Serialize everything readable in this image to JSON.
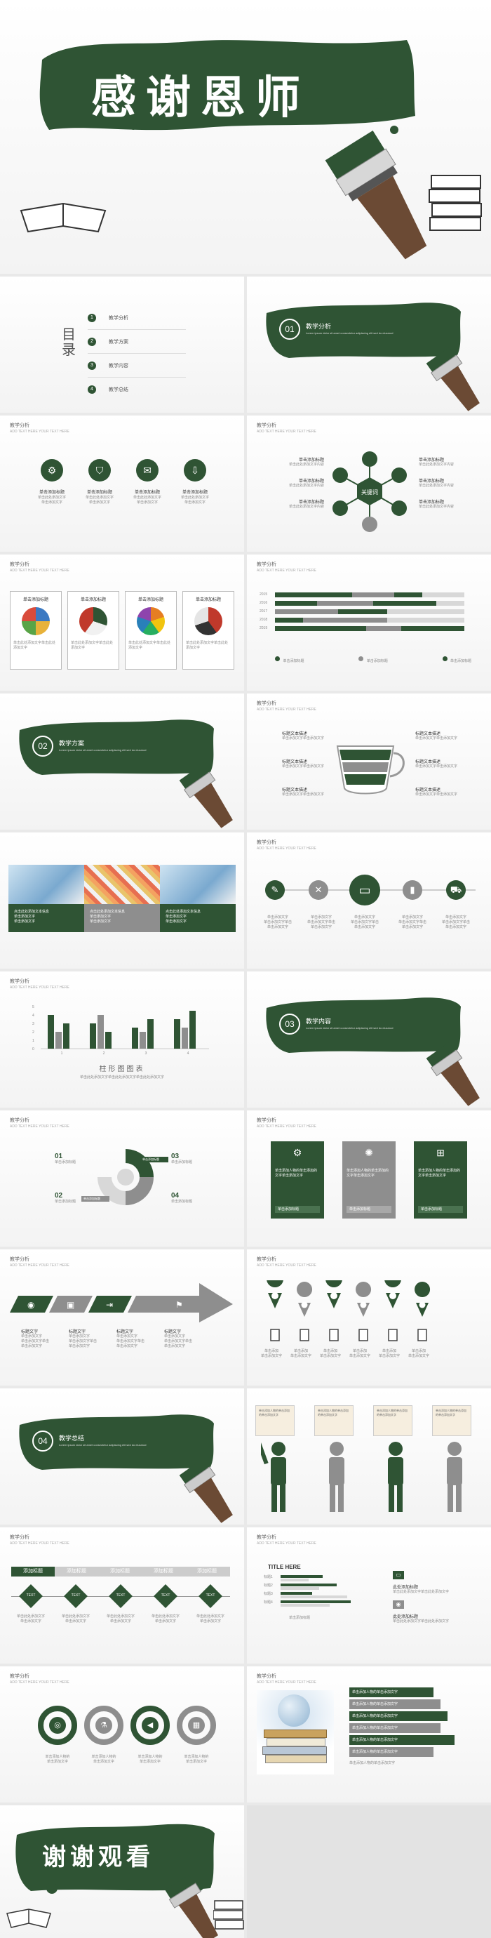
{
  "cover": {
    "title": "感谢恩师"
  },
  "toc": {
    "heading": "目录",
    "items": [
      {
        "num": "1",
        "label": "教学分析"
      },
      {
        "num": "2",
        "label": "教学方案"
      },
      {
        "num": "3",
        "label": "教学内容"
      },
      {
        "num": "4",
        "label": "教学总结"
      }
    ]
  },
  "header": {
    "title": "教学分析",
    "subtitle": "ADD TEXT HERE YOUR TEXT HERE"
  },
  "sections": [
    {
      "num": "01",
      "title": "教学分析",
      "sub": "Lorem ipsum dolor sit amet consectetur adipiscing elit sed do eiusmod"
    },
    {
      "num": "02",
      "title": "教学方案",
      "sub": "Lorem ipsum dolor sit amet consectetur adipiscing elit sed do eiusmod"
    },
    {
      "num": "03",
      "title": "教学内容",
      "sub": "Lorem ipsum dolor sit amet consectetur adipiscing elit sed do eiusmod"
    },
    {
      "num": "04",
      "title": "教学总结",
      "sub": "Lorem ipsum dolor sit amet consectetur adipiscing elit sed do eiusmod"
    }
  ],
  "four_icons": {
    "title": "单击添加标题",
    "desc": "单击此处添加文字\n单击添加文字"
  },
  "hub": {
    "center": "关键词",
    "label": "单击添加标题",
    "desc": "单击此处添加文字内容"
  },
  "cards": {
    "title": "单击添加标题",
    "desc": "单击此处添加文字单击此处添加文字"
  },
  "hbar": {
    "rows": [
      "2015",
      "2016",
      "2017",
      "2018",
      "2019"
    ],
    "legend": [
      "单击添加标题",
      "单击添加标题",
      "单击添加标题"
    ]
  },
  "cup": {
    "label": "标题文本描述",
    "desc": "单击添加文字单击添加文字"
  },
  "photos": {
    "desc": "点击此处添加文本信息\n单击添加文字\n单击添加文字"
  },
  "five_icons": {
    "desc": "单击添加文字\n单击添加文字单击\n单击添加文字"
  },
  "bars": {
    "caption": "柱形图图表",
    "y_ticks": [
      "5",
      "4",
      "3",
      "2",
      "1",
      "0"
    ],
    "categories": [
      "1",
      "2",
      "3",
      "4"
    ],
    "desc": "单击此处添加文字单击此处添加文字单击此处添加文字"
  },
  "donut": {
    "items": [
      {
        "num": "01",
        "label": "单击添加标题"
      },
      {
        "num": "02",
        "label": "单击添加标题"
      },
      {
        "num": "03",
        "label": "单击添加标题"
      },
      {
        "num": "04",
        "label": "单击添加标题"
      }
    ],
    "tags": [
      "单击添加标题",
      "单击添加标题"
    ]
  },
  "panels": {
    "text": "单击添加人物的单击添加的文字单击添加文字",
    "btn": "单击添加标题"
  },
  "arrow": {
    "labels": [
      "标题文字",
      "标题文字",
      "标题文字",
      "标题文字"
    ],
    "desc": "单击添加文字\n单击添加文字单击\n单击添加文字"
  },
  "pins": {
    "desc": "单击添加\n单击添加文字"
  },
  "people": {
    "bubble": "单击添加人物的单击添加的单击添加文字"
  },
  "timeline": {
    "steps": [
      "添加标题",
      "添加标题",
      "添加标题",
      "添加标题",
      "添加标题"
    ],
    "text": "TEXT",
    "desc": "单击此处添加文字\n单击添加文字"
  },
  "hbars2": {
    "title": "TITLE HERE",
    "rows": [
      "标题1",
      "标题2",
      "标题3",
      "标题4"
    ],
    "xlabel": "单击添加标题",
    "side": [
      "此处添加标题",
      "此处添加标题"
    ],
    "side_desc": "单击此处添加文字单击此处添加文字"
  },
  "rings": {
    "desc": "单击添加人物的\n单击添加文字"
  },
  "books": {
    "row": "单击添加人物的单击添加文字",
    "desc": "单击添加人物的单击添加文字"
  },
  "ending": {
    "title": "谢谢观看"
  },
  "colors": {
    "green": "#2f5434",
    "gray": "#8e8e8e",
    "light": "#d8d8d8"
  }
}
